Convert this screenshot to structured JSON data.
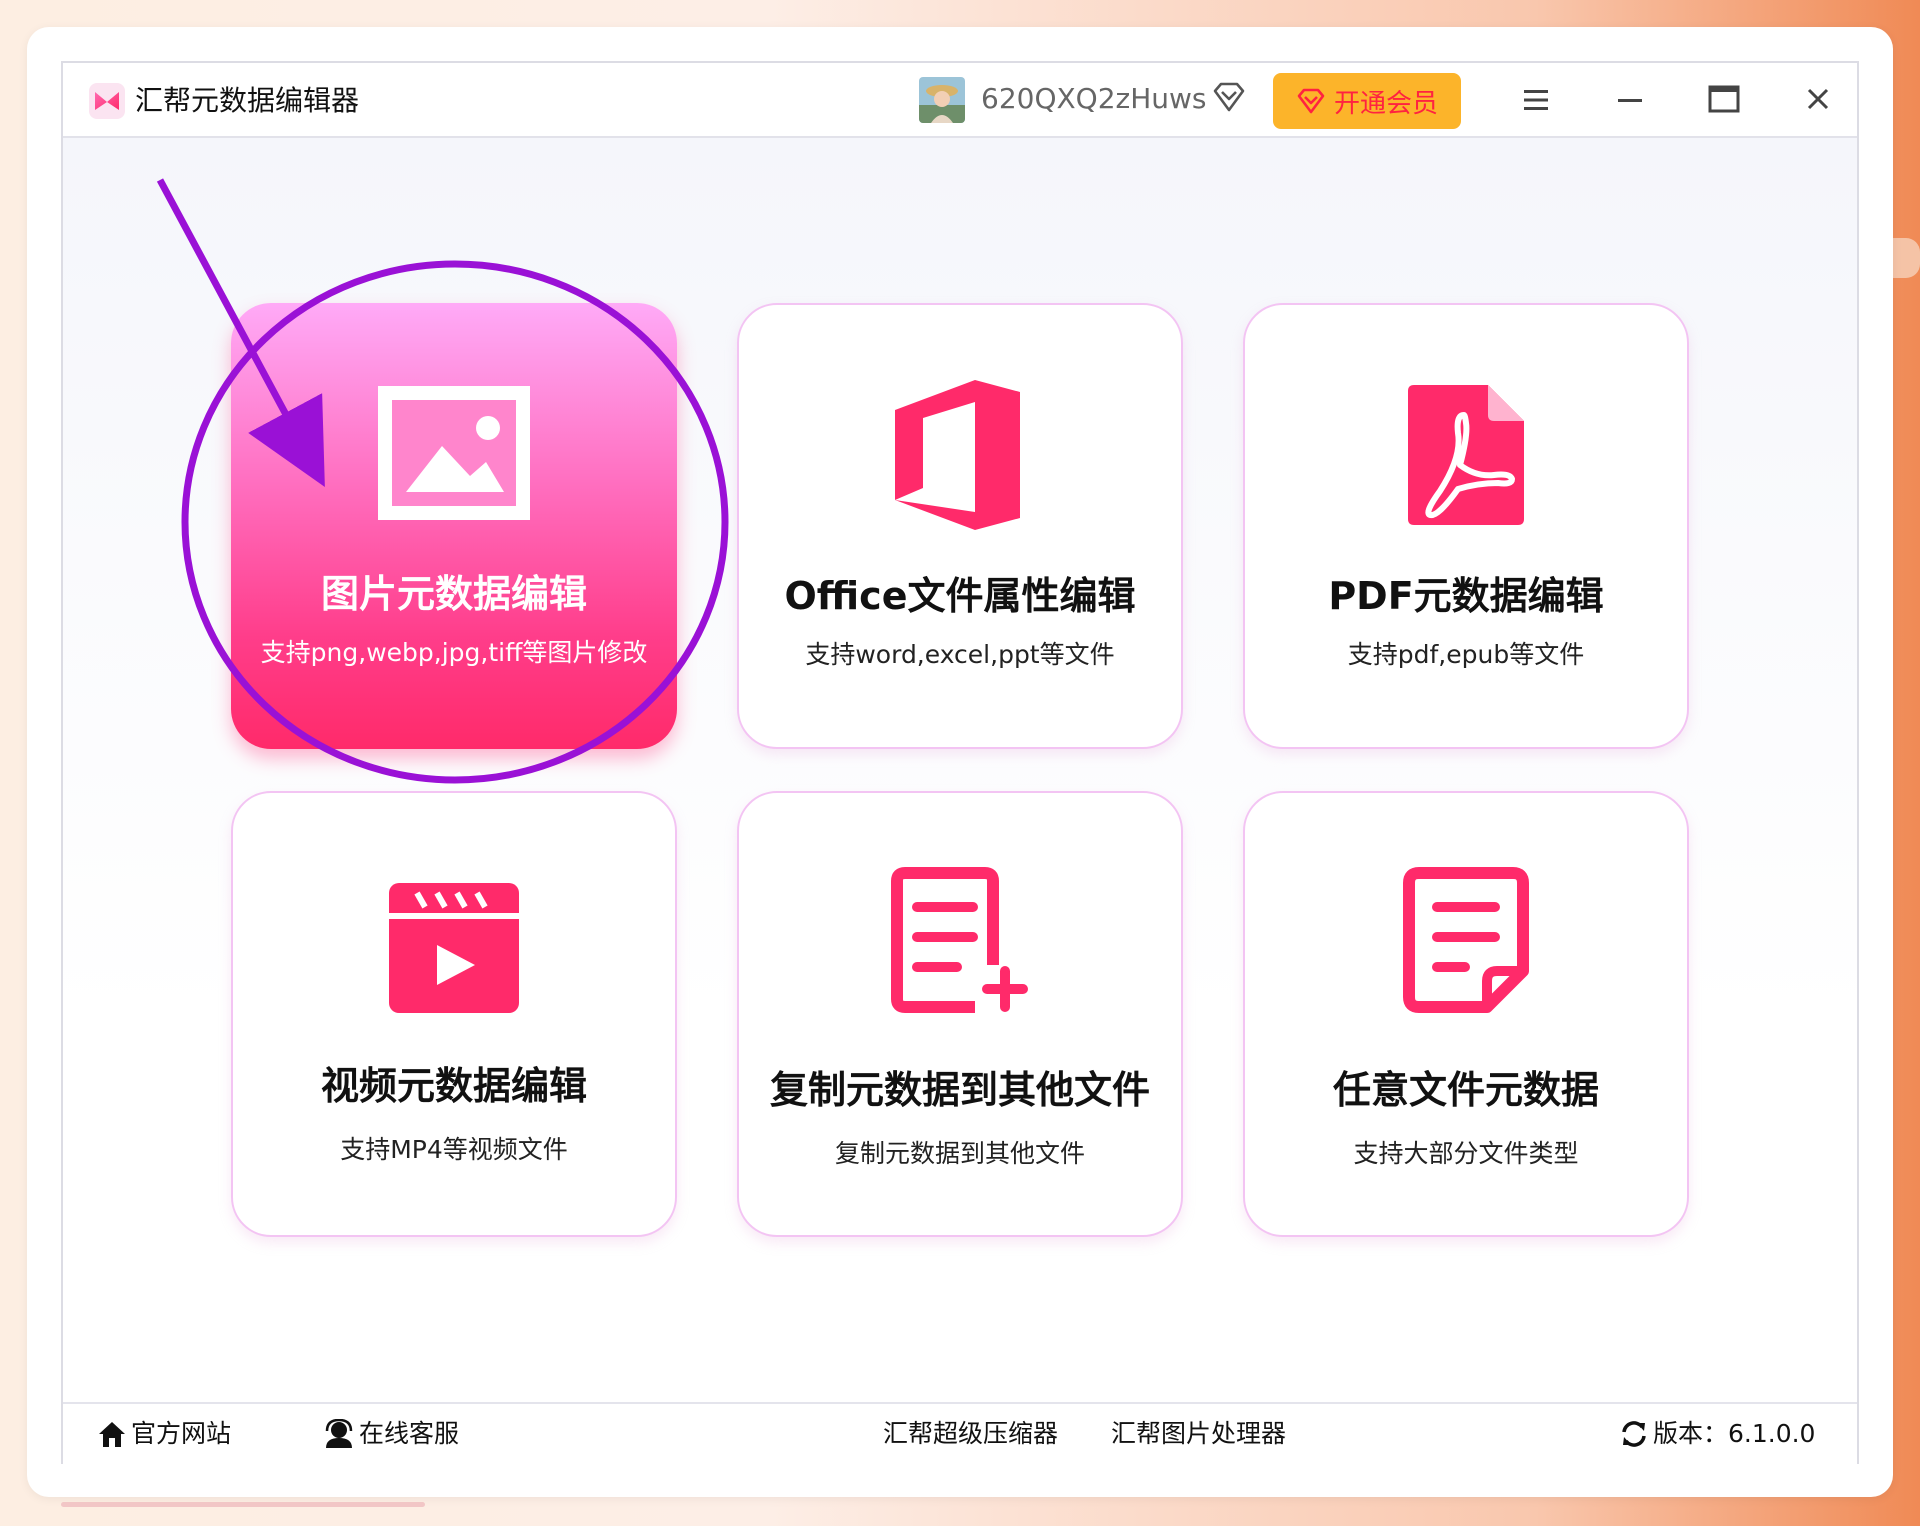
{
  "app": {
    "title": "汇帮元数据编辑器",
    "icon": "app-logo-icon"
  },
  "header": {
    "username": "620QXQ2zHuws",
    "vip_button_label": "开通会员",
    "icons": [
      "avatar",
      "vip-diamond-icon",
      "heart-diamond-icon",
      "menu-icon",
      "minimize-icon",
      "maximize-icon",
      "close-icon"
    ]
  },
  "cards": [
    {
      "title": "图片元数据编辑",
      "desc": "支持png,webp,jpg,tiff等图片修改",
      "icon": "image-icon",
      "active": true
    },
    {
      "title": "Office文件属性编辑",
      "desc": "支持word,excel,ppt等文件",
      "icon": "office-icon",
      "active": false
    },
    {
      "title": "PDF元数据编辑",
      "desc": "支持pdf,epub等文件",
      "icon": "pdf-icon",
      "active": false
    },
    {
      "title": "视频元数据编辑",
      "desc": "支持MP4等视频文件",
      "icon": "video-icon",
      "active": false
    },
    {
      "title": "复制元数据到其他文件",
      "desc": "复制元数据到其他文件",
      "icon": "document-add-icon",
      "active": false
    },
    {
      "title": "任意文件元数据",
      "desc": "支持大部分文件类型",
      "icon": "document-icon",
      "active": false
    }
  ],
  "footer": {
    "official_site": "官方网站",
    "online_service": "在线客服",
    "compressor": "汇帮超级压缩器",
    "image_processor": "汇帮图片处理器",
    "version_label": "版本：6.1.0.0",
    "icons": [
      "home-icon",
      "customer-service-icon",
      "refresh-icon"
    ]
  },
  "colors": {
    "accent": "#ff2a6a",
    "vip_bg": "#fcb42a",
    "vip_text": "#ff2240",
    "annotation": "#9a11d6",
    "card_border": "#f3c4f3"
  }
}
